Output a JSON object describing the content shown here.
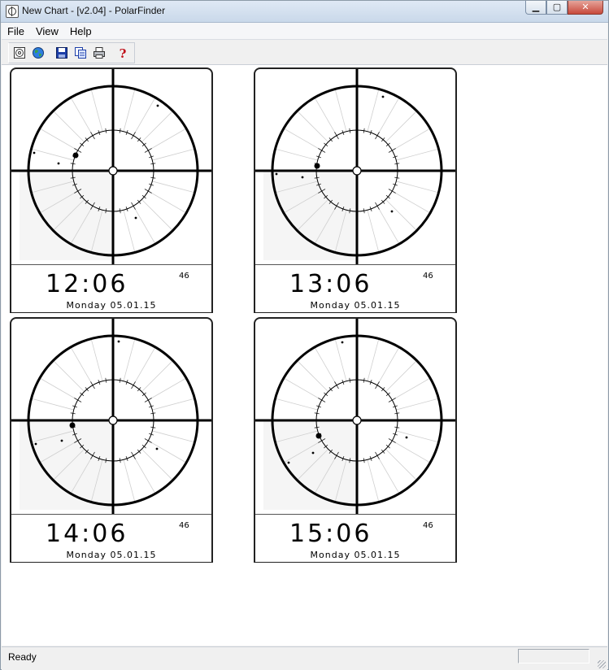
{
  "window": {
    "title": "New Chart - [v2.04] - PolarFinder"
  },
  "menu": [
    "File",
    "View",
    "Help"
  ],
  "toolbar": {
    "buttons": [
      "new-chart-icon",
      "globe-icon",
      "save-icon",
      "copy-icon",
      "print-icon",
      "help-icon"
    ]
  },
  "charts": [
    {
      "time": "12:06",
      "seconds": "46",
      "date": "Monday 05.01.15"
    },
    {
      "time": "13:06",
      "seconds": "46",
      "date": "Monday 05.01.15"
    },
    {
      "time": "14:06",
      "seconds": "46",
      "date": "Monday 05.01.15"
    },
    {
      "time": "15:06",
      "seconds": "46",
      "date": "Monday 05.01.15"
    }
  ],
  "status": {
    "text": "Ready"
  }
}
